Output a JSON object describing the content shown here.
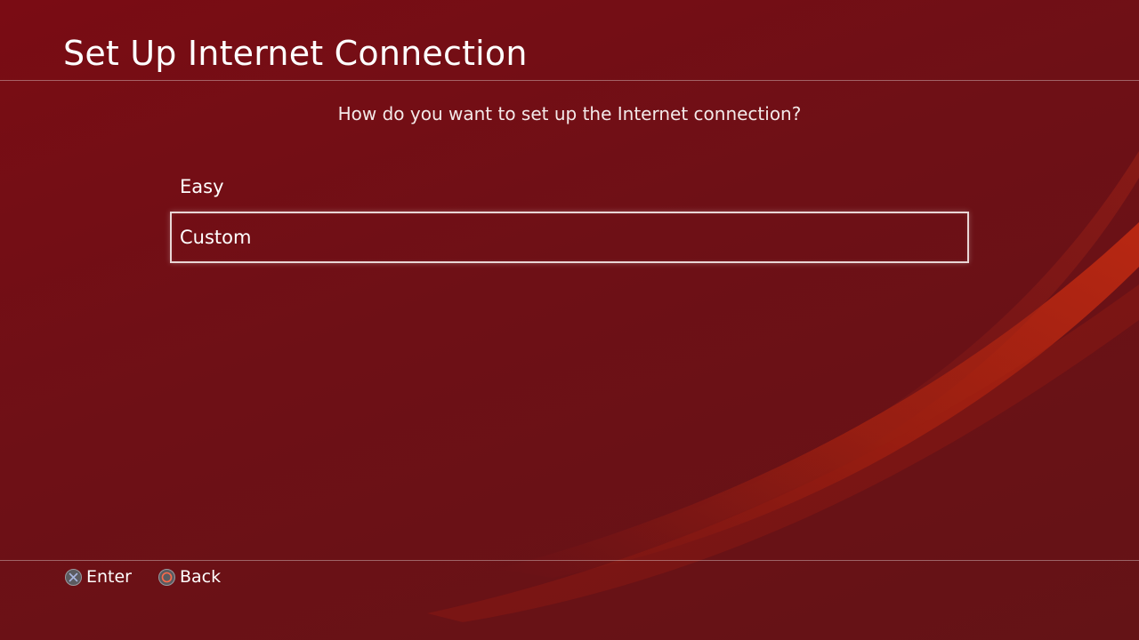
{
  "header": {
    "title": "Set Up Internet Connection"
  },
  "prompt": "How do you want to set up the Internet connection?",
  "menu": {
    "items": [
      {
        "label": "Easy",
        "selected": false
      },
      {
        "label": "Custom",
        "selected": true
      }
    ]
  },
  "footer": {
    "enter": {
      "icon": "cross-button-icon",
      "label": "Enter"
    },
    "back": {
      "icon": "circle-button-icon",
      "label": "Back"
    }
  },
  "colors": {
    "background": "#6e1016",
    "accent_swoosh": "#b8240f",
    "text": "#ffffff",
    "selection_border": "#e9d6d6"
  }
}
